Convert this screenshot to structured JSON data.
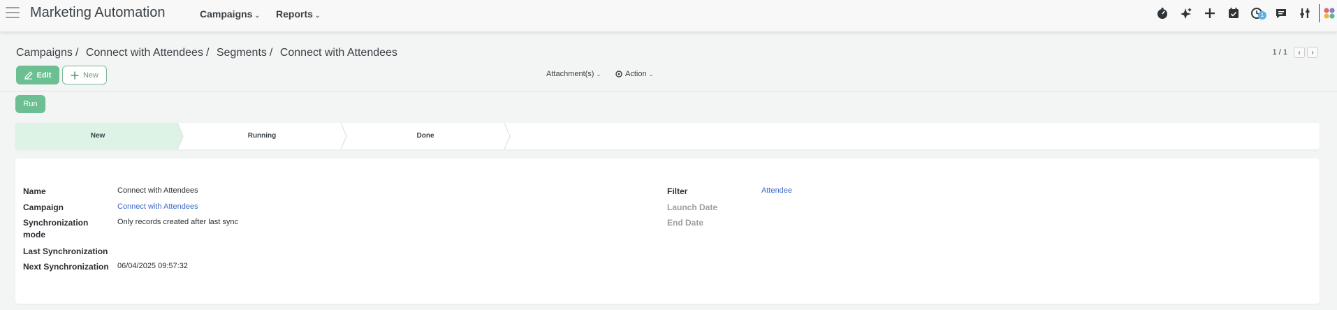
{
  "navbar": {
    "app_title": "Marketing Automation",
    "menus": [
      "Campaigns",
      "Reports"
    ],
    "activity_badge": "1"
  },
  "breadcrumb": {
    "items": [
      "Campaigns",
      "Connect with Attendees",
      "Segments"
    ],
    "current": "Connect with Attendees"
  },
  "pager": {
    "value": "1 / 1"
  },
  "toolbar": {
    "edit_label": "Edit",
    "new_label": "New",
    "attachments_label": "Attachment(s)",
    "action_label": "Action",
    "run_label": "Run"
  },
  "statusbar": {
    "stages": [
      "New",
      "Running",
      "Done"
    ],
    "active": "New",
    "active_color": "#dcf3e6"
  },
  "form": {
    "left": [
      {
        "label": "Name",
        "value": "Connect with Attendees",
        "link": false
      },
      {
        "label": "Campaign",
        "value": "Connect with Attendees",
        "link": true
      },
      {
        "label": "Synchronization mode",
        "value": "Only records created after last sync",
        "link": false
      },
      {
        "label": "Last Synchronization",
        "value": "",
        "link": false
      },
      {
        "label": "Next Synchronization",
        "value": "06/04/2025 09:57:32",
        "link": false
      }
    ],
    "right": [
      {
        "label": "Filter",
        "value": "Attendee",
        "link": true
      },
      {
        "label": "Launch Date",
        "value": "",
        "link": false
      },
      {
        "label": "End Date",
        "value": "",
        "link": false
      }
    ]
  },
  "colors": {
    "primary": "#6bbf92",
    "link": "#3d68c9",
    "badge": "#5db0e4"
  }
}
